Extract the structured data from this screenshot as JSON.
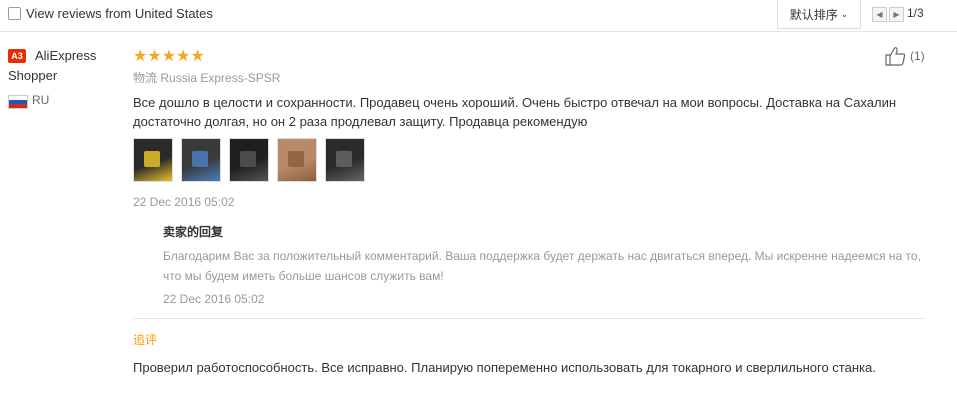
{
  "toolbar": {
    "filter_label": "View reviews from United States",
    "sort_label": "默认排序",
    "page_indicator": "1/3"
  },
  "reviewer": {
    "avatar_text": "A3",
    "name": "AliExpress Shopper",
    "country": "RU"
  },
  "review": {
    "stars": "★★★★★",
    "rating": 5,
    "logistics_label": "物流",
    "logistics_value": "Russia Express-SPSR",
    "text": "Все дошло в целости и сохранности. Продавец очень хороший. Очень быстро отвечал на мои вопросы. Доставка на Сахалин достаточно долгая, но он 2 раза продлевал защиту. Продавца рекомендую",
    "date": "22 Dec 2016 05:02",
    "helpful_count": "(1)",
    "thumbnails": [
      {
        "name": "photo-1",
        "colors": [
          "#2a2a2a",
          "#e6c229"
        ]
      },
      {
        "name": "photo-2",
        "colors": [
          "#3a3a3a",
          "#4a7fc1"
        ]
      },
      {
        "name": "photo-3",
        "colors": [
          "#1f1f1f",
          "#555555"
        ]
      },
      {
        "name": "photo-4",
        "colors": [
          "#b98a6a",
          "#8b5e3c"
        ]
      },
      {
        "name": "photo-5",
        "colors": [
          "#2b2b2b",
          "#666666"
        ]
      }
    ]
  },
  "seller_reply": {
    "title": "卖家的回复",
    "text": "Благодарим Вас за положительный комментарий. Ваша поддержка будет держать нас двигаться вперед. Мы искренне надеемся на то, что мы будем иметь больше шансов служить вам!",
    "date": "22 Dec 2016 05:02"
  },
  "followup": {
    "title": "追评",
    "text": "Проверил работоспособность. Все исправно. Планирую попеременно использовать для токарного и сверлильного станка."
  },
  "colors": {
    "star": "#f5a623",
    "accent_orange": "#ff9900",
    "avatar_bg": "#e62e04"
  }
}
